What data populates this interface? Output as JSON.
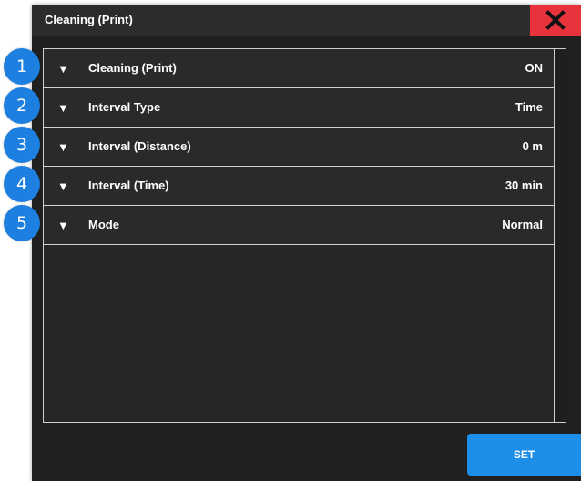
{
  "window": {
    "title": "Cleaning (Print)",
    "close_icon": "close-x-icon",
    "accent_close": "#e8323c"
  },
  "settings": [
    {
      "number": "1",
      "label": "Cleaning (Print)",
      "value": "ON"
    },
    {
      "number": "2",
      "label": "Interval Type",
      "value": "Time"
    },
    {
      "number": "3",
      "label": "Interval (Distance)",
      "value": "0 m"
    },
    {
      "number": "4",
      "label": "Interval (Time)",
      "value": "30 min"
    },
    {
      "number": "5",
      "label": "Mode",
      "value": "Normal"
    }
  ],
  "expand_icon": "triangle-down-icon",
  "footer": {
    "set_label": "SET",
    "accent": "#1e8fe8"
  },
  "badge_color": "#1d7fe0"
}
